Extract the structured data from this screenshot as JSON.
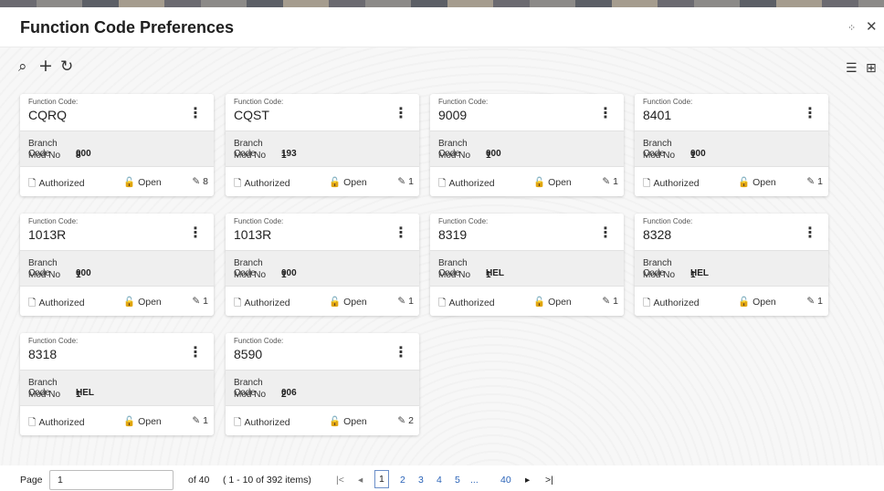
{
  "title": "Function Code Preferences",
  "colors": {
    "link": "#2a63b8",
    "card_mid_bg": "#efefef",
    "header_bg": "#ffffff"
  },
  "header_icons": [
    "minimize-icon",
    "close-icon"
  ],
  "toolbar_icons": [
    "search-icon",
    "add-icon",
    "refresh-icon"
  ],
  "view_icons": [
    "list-view-icon",
    "tile-view-icon"
  ],
  "labels": {
    "function_code": "Function Code:",
    "branch_code": "Branch Code",
    "mod_no": "Mod No",
    "authorized": "Authorized",
    "open": "Open"
  },
  "cards": [
    {
      "code": "CQRQ",
      "branch": "000",
      "mod": "8",
      "mods_count": "8"
    },
    {
      "code": "CQST",
      "branch": "193",
      "mod": "1",
      "mods_count": "1"
    },
    {
      "code": "9009",
      "branch": "000",
      "mod": "1",
      "mods_count": "1"
    },
    {
      "code": "8401",
      "branch": "000",
      "mod": "1",
      "mods_count": "1"
    },
    {
      "code": "1013R",
      "branch": "000",
      "mod": "1",
      "mods_count": "1"
    },
    {
      "code": "1013R",
      "branch": "000",
      "mod": "1",
      "mods_count": "1"
    },
    {
      "code": "8319",
      "branch": "HEL",
      "mod": "1",
      "mods_count": "1"
    },
    {
      "code": "8328",
      "branch": "HEL",
      "mod": "1",
      "mods_count": "1"
    },
    {
      "code": "8318",
      "branch": "HEL",
      "mod": "1",
      "mods_count": "1"
    },
    {
      "code": "8590",
      "branch": "006",
      "mod": "2",
      "mods_count": "2"
    }
  ],
  "pagination": {
    "page_label": "Page",
    "page_value": "1",
    "of_label": "of 40",
    "items_label": "( 1 - 10 of 392 items)",
    "first": "|<",
    "prev": "◂",
    "pages": [
      "1",
      "2",
      "3",
      "4",
      "5",
      "...",
      "40"
    ],
    "next": "▸",
    "last": ">|"
  }
}
